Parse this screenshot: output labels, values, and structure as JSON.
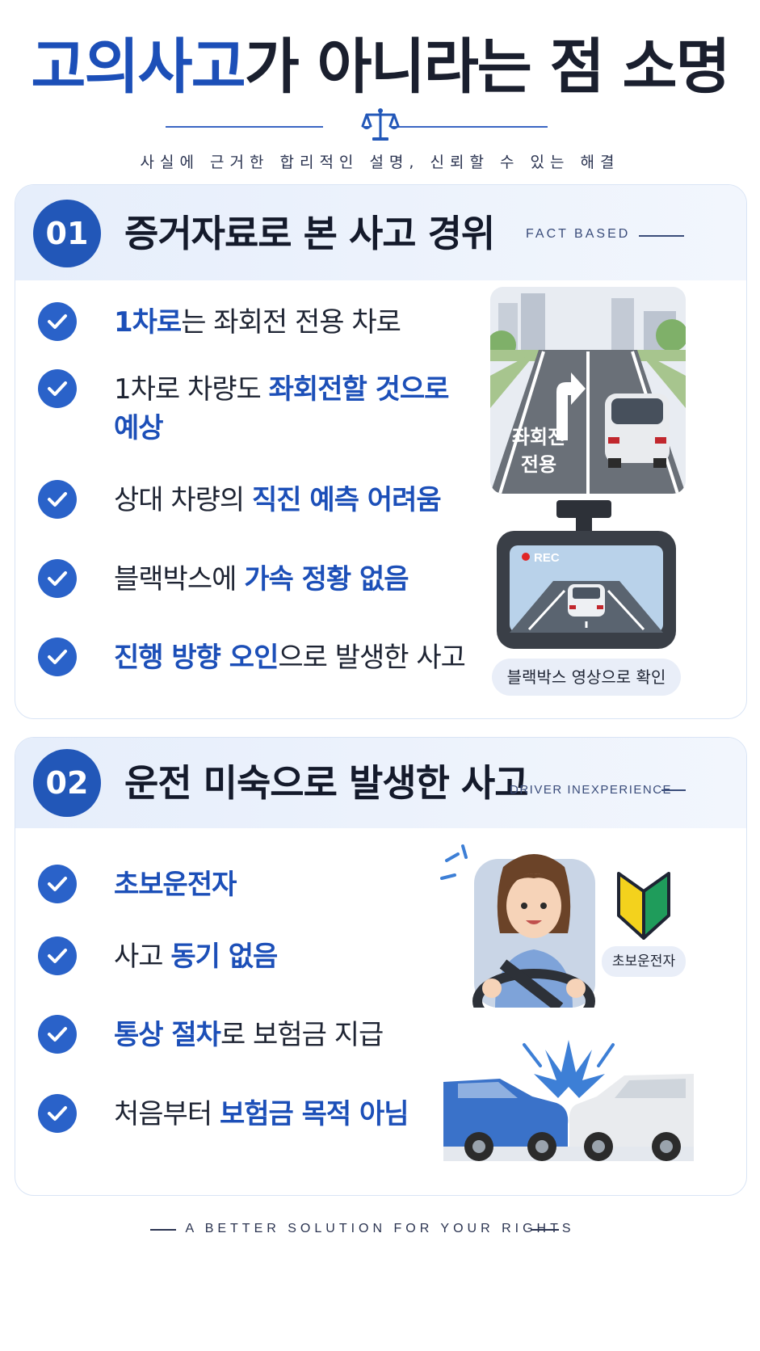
{
  "title": {
    "highlight": "고의사고",
    "rest": "가 아니라는 점 소명"
  },
  "subtitle": "사실에 근거한 합리적인 설명, 신뢰할 수 있는 해결",
  "section1": {
    "number": "01",
    "title": "증거자료로 본 사고 경위",
    "tag": "FACT BASED",
    "items": [
      {
        "bold": "1차로",
        "rest": "는 좌회전 전용 차로"
      },
      {
        "normal": "1차로 차량도 ",
        "bold": "좌회전할 것으로",
        "bold2": "예상"
      },
      {
        "normal": "상대 차량의 ",
        "bold": "직진 예측 어려움"
      },
      {
        "normal": "블랙박스에 ",
        "bold": "가속 정황 없음"
      },
      {
        "bold": "진행 방향 오인",
        "rest": "으로 발생한 사고"
      }
    ],
    "road_sign": "좌회전\n전용",
    "rec_label": "REC",
    "caption": "블랙박스 영상으로 확인"
  },
  "section2": {
    "number": "02",
    "title": "운전 미숙으로 발생한 사고",
    "tag": "DRIVER INEXPERIENCE",
    "items": [
      {
        "bold": "초보운전자"
      },
      {
        "normal": "사고 ",
        "bold": "동기 없음"
      },
      {
        "bold": "통상 절차",
        "rest": "로 보험금 지급"
      },
      {
        "normal": "처음부터 ",
        "bold": "보험금 목적 아님"
      }
    ],
    "badge_label": "초보운전자"
  },
  "footer": "A BETTER SOLUTION FOR YOUR RIGHTS",
  "colors": {
    "accent": "#1c4fb8",
    "check": "#2a62c9",
    "head_bg": "#e6eefb"
  }
}
